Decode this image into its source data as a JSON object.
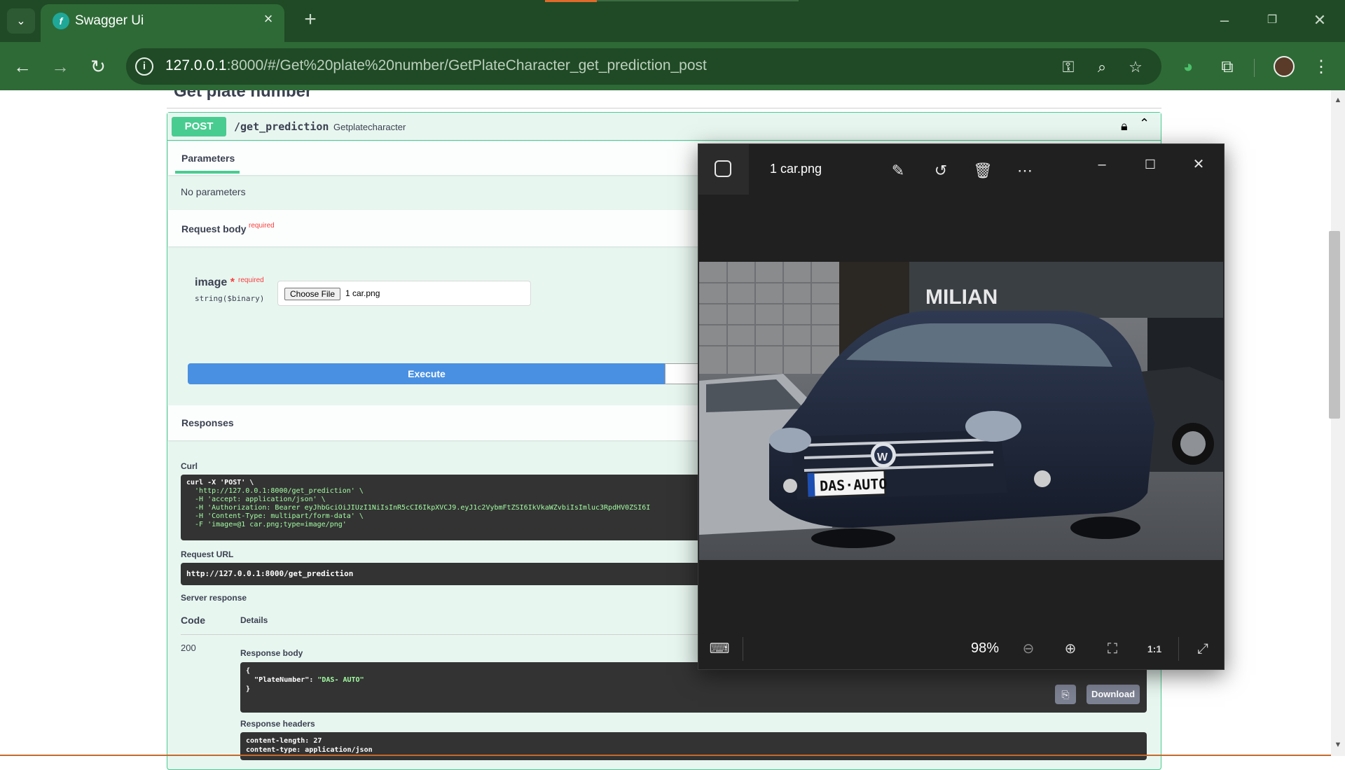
{
  "browser": {
    "tab_title": "Swagger Ui",
    "url_host": "127.0.0.1",
    "url_rest": ":8000/#/Get%20plate%20number/GetPlateCharacter_get_prediction_post"
  },
  "swagger": {
    "section_title": "Get plate number",
    "operation": {
      "method": "POST",
      "path": "/get_prediction",
      "description": "Getplatecharacter"
    },
    "parameters_tab": "Parameters",
    "no_parameters": "No parameters",
    "request_body_label": "Request body",
    "required_label": "required",
    "param": {
      "name": "image",
      "star": "*",
      "required": "required",
      "type": "string($binary)",
      "choose_file_label": "Choose File",
      "file_name": "1 car.png"
    },
    "execute_label": "Execute",
    "responses_label": "Responses",
    "curl_label": "Curl",
    "curl_lines": [
      "curl -X 'POST' \\",
      "  'http://127.0.0.1:8000/get_prediction' \\",
      "  -H 'accept: application/json' \\",
      "  -H 'Authorization: Bearer eyJhbGciOiJIUzI1NiIsInR5cCI6IkpXVCJ9.eyJ1c2VybmFtZSI6IkVkaWZvbiIsImluc3RpdHV0ZSI6I",
      "  -H 'Content-Type: multipart/form-data' \\",
      "  -F 'image=@1 car.png;type=image/png'"
    ],
    "request_url_label": "Request URL",
    "request_url": "http://127.0.0.1:8000/get_prediction",
    "server_response_label": "Server response",
    "code_header": "Code",
    "details_header": "Details",
    "status_code": "200",
    "response_body_label": "Response body",
    "response_body": {
      "open": "{",
      "key": "\"PlateNumber\"",
      "value": "\"DAS- AUTO\"",
      "close": "}"
    },
    "download_label": "Download",
    "response_headers_label": "Response headers",
    "response_headers": [
      "content-length: 27",
      "content-type: application/json"
    ]
  },
  "photos_viewer": {
    "title": "1 car.png",
    "zoom": "98%",
    "image_text": {
      "storefront": "MILIAN",
      "plate": "DAS·AUTO"
    }
  }
}
